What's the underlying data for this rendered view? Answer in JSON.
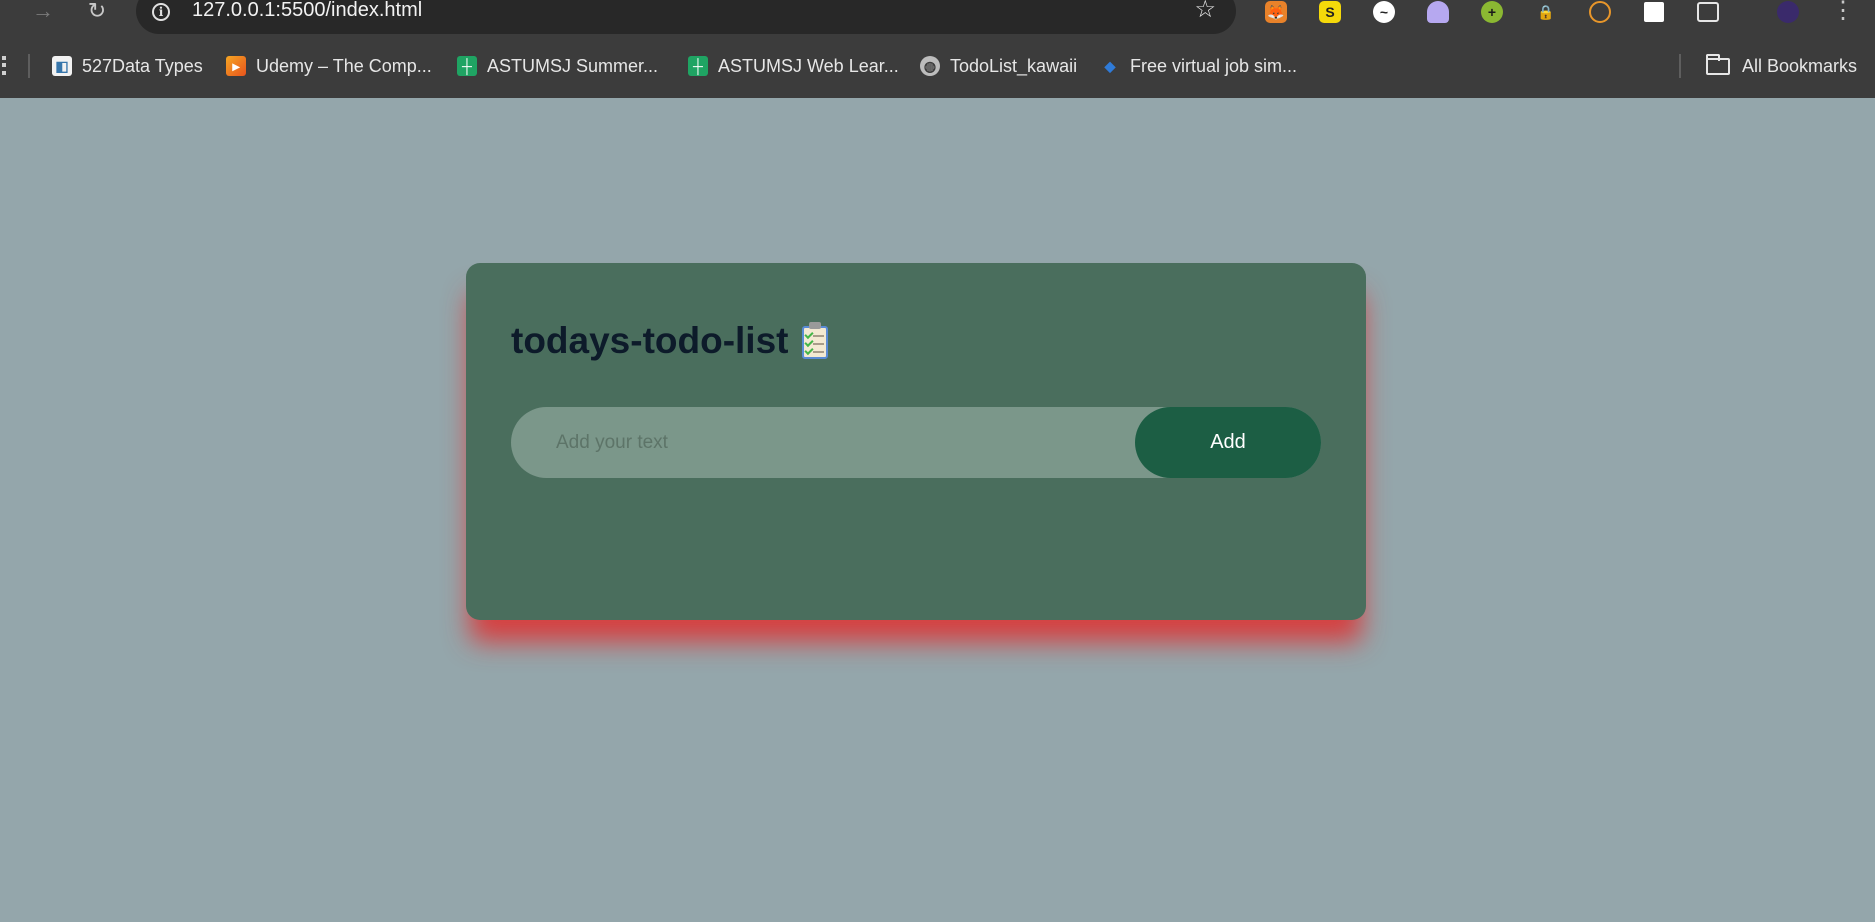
{
  "browser": {
    "url": "127.0.0.1:5500/index.html",
    "bookmarks": [
      {
        "label": "527Data Types",
        "icon": "python-doc-icon"
      },
      {
        "label": "Udemy – The Comp...",
        "icon": "udemy-icon"
      },
      {
        "label": "ASTUMSJ Summer...",
        "icon": "google-sheets-icon"
      },
      {
        "label": "ASTUMSJ Web Lear...",
        "icon": "google-sheets-icon"
      },
      {
        "label": "TodoList_kawaii",
        "icon": "globe-icon"
      },
      {
        "label": "Free virtual job sim...",
        "icon": "forage-icon"
      }
    ],
    "all_bookmarks_label": "All Bookmarks",
    "extensions": [
      "metamask-icon",
      "stack-icon",
      "graph-icon",
      "ghost-icon",
      "plus-circle-icon",
      "lock-icon",
      "timer-icon",
      "chart-icon",
      "puzzle-icon"
    ]
  },
  "app": {
    "title": "todays-todo-list",
    "input_placeholder": "Add your text",
    "input_value": "",
    "add_label": "Add"
  },
  "colors": {
    "page_background": "#94a6ab",
    "card_background": "#4a6e5d",
    "card_shadow": "#e22e2e",
    "input_background": "#7b978a",
    "button_background": "#1c5e44",
    "title_color": "#0d1b2a"
  }
}
